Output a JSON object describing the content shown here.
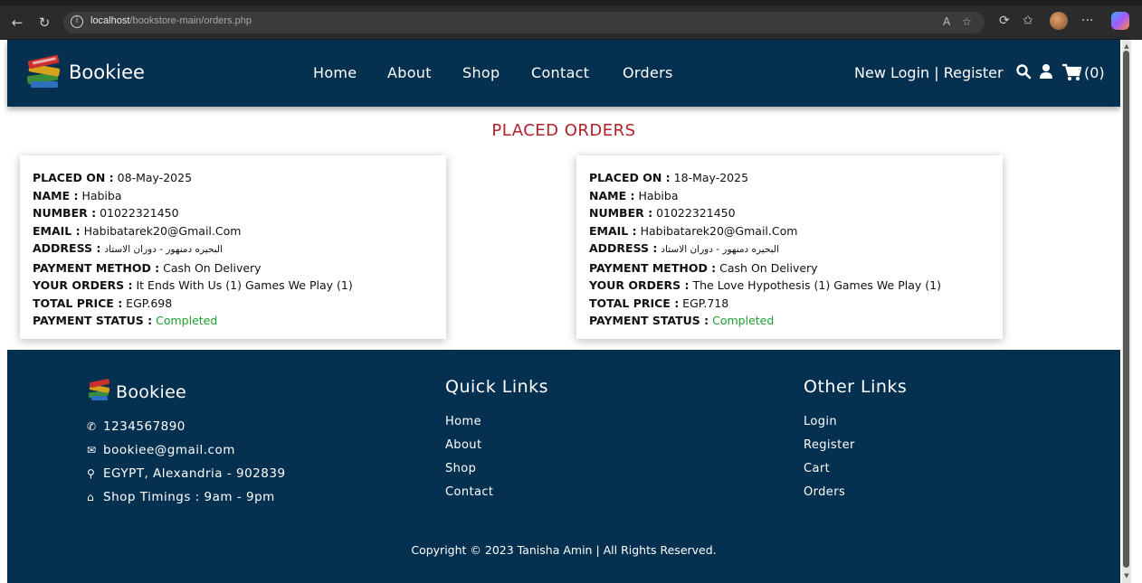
{
  "browser": {
    "url_host": "localhost",
    "url_path": "/bookstore-main/orders.php",
    "icons": [
      "back-icon",
      "reload-icon",
      "info-icon",
      "read-aloud-icon",
      "favorite-star-icon",
      "extensions-icon",
      "favorites-icon",
      "profile-avatar",
      "more-icon",
      "copilot-icon"
    ]
  },
  "header": {
    "brand": "Bookiee",
    "nav": [
      "Home",
      "About",
      "Shop",
      "Contact",
      "Orders"
    ],
    "auth": "New Login | Register",
    "cart": "(0)"
  },
  "main": {
    "title": "PLACED ORDERS",
    "orders": [
      {
        "placed_on_label": "PLACED ON :",
        "placed_on": " 08-May-2025",
        "name_label": "NAME :",
        "name": " Habiba",
        "number_label": "NUMBER :",
        "number": " 01022321450",
        "email_label": "EMAIL :",
        "email": " Habibatarek20@Gmail.Com",
        "address_label": "ADDRESS :",
        "address": "البحيره دمنهور - دوران الاستاد",
        "payment_method_label": "PAYMENT METHOD :",
        "payment_method": " Cash On Delivery",
        "your_orders_label": "YOUR ORDERS :",
        "your_orders": " It Ends With Us (1) Games We Play (1)",
        "total_price_label": "TOTAL PRICE :",
        "total_price": " EGP.698",
        "payment_status_label": "PAYMENT STATUS :",
        "payment_status": " Completed"
      },
      {
        "placed_on_label": "PLACED ON :",
        "placed_on": " 18-May-2025",
        "name_label": "NAME :",
        "name": " Habiba",
        "number_label": "NUMBER :",
        "number": " 01022321450",
        "email_label": "EMAIL :",
        "email": " Habibatarek20@Gmail.Com",
        "address_label": "ADDRESS :",
        "address": "البحيره دمنهور - دوران الاستاد",
        "payment_method_label": "PAYMENT METHOD :",
        "payment_method": " Cash On Delivery",
        "your_orders_label": "YOUR ORDERS :",
        "your_orders": " The Love Hypothesis (1) Games We Play (1)",
        "total_price_label": "TOTAL PRICE :",
        "total_price": " EGP.718",
        "payment_status_label": "PAYMENT STATUS :",
        "payment_status": " Completed"
      }
    ]
  },
  "footer": {
    "brand": "Bookiee",
    "phone": "1234567890",
    "email": "bookiee@gmail.com",
    "location": "EGYPT, Alexandria - 902839",
    "timings": "Shop Timings : 9am - 9pm",
    "quick_links_heading": "Quick Links",
    "quick_links": [
      "Home",
      "About",
      "Shop",
      "Contact"
    ],
    "other_links_heading": "Other Links",
    "other_links": [
      "Login",
      "Register",
      "Cart",
      "Orders"
    ],
    "copyright": "Copyright © 2023 Tanisha Amin | All Rights Reserved."
  },
  "colors": {
    "header_bg": "#05304f",
    "title_red": "#b4202a",
    "status_green": "#1e9e2e"
  }
}
